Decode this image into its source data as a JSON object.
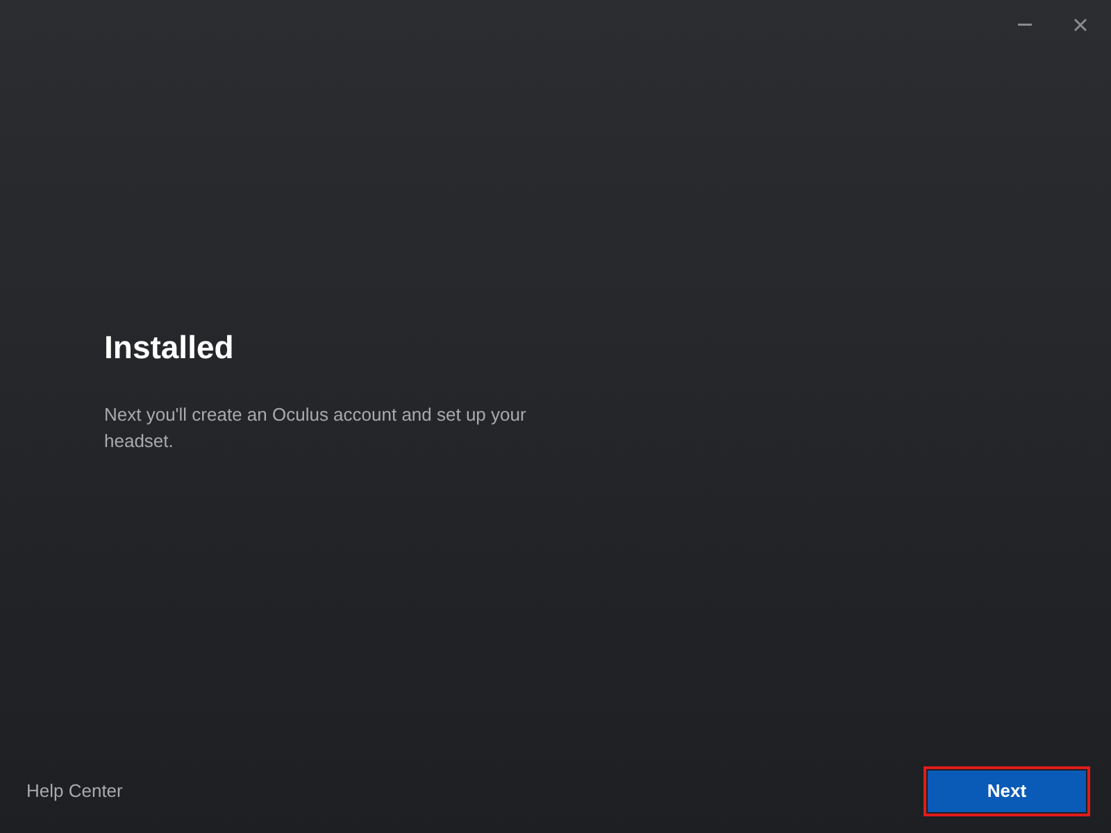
{
  "title": "Installed",
  "message": "Next you'll create an Oculus account and set up your headset.",
  "footer": {
    "help_link": "Help Center",
    "next_button": {
      "label": "Next",
      "highlighted": true
    }
  }
}
